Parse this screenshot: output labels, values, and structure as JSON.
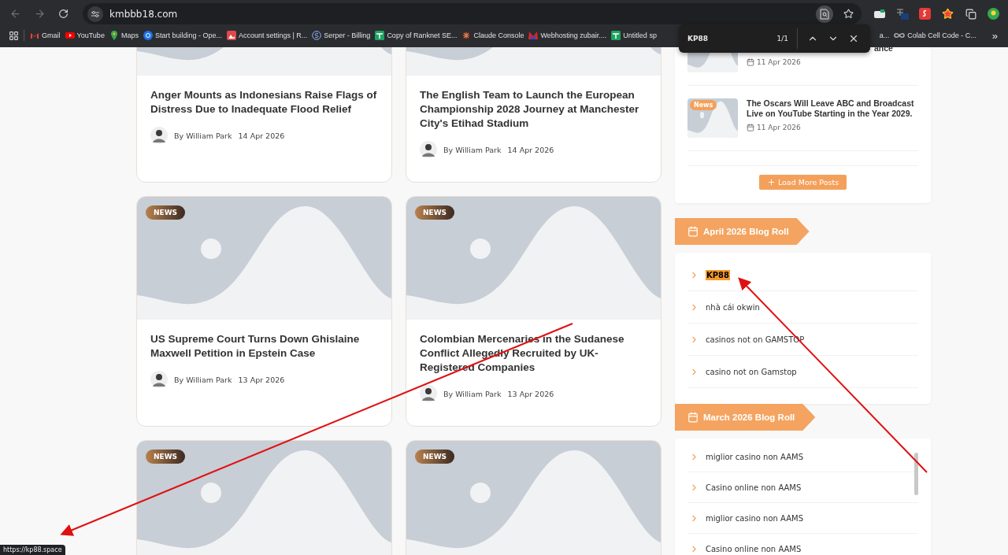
{
  "browser": {
    "url": "kmbbb18.com",
    "bookmarks": [
      {
        "label": "Gmail",
        "kind": "mail"
      },
      {
        "label": "YouTube",
        "kind": "video"
      },
      {
        "label": "Maps",
        "kind": "pin"
      },
      {
        "label": "Start building - Ope...",
        "kind": "gear"
      },
      {
        "label": "Account settings | R...",
        "kind": "photo"
      },
      {
        "label": "Serper - Billing",
        "kind": "circle"
      },
      {
        "label": "Copy of Ranknet SE...",
        "kind": "sheet"
      },
      {
        "label": "Claude Console",
        "kind": "burst"
      },
      {
        "label": "Webhosting zubair....",
        "kind": "letter"
      },
      {
        "label": "Untitled sp",
        "kind": "sheet"
      },
      {
        "label": "a...",
        "kind": "plain"
      },
      {
        "label": "Colab Cell Code - C...",
        "kind": "loop"
      }
    ],
    "more": "»"
  },
  "find_bar": {
    "query": "KP88",
    "count": "1/1"
  },
  "posts": [
    {
      "title": "Anger Mounts as Indonesians Raise Flags of Distress Due to Inadequate Flood Relief",
      "author": "By William Park",
      "date": "14 Apr 2026"
    },
    {
      "title": "The English Team to Launch the European Championship 2028 Journey at Manchester City's Etihad Stadium",
      "author": "By William Park",
      "date": "14 Apr 2026"
    },
    {
      "badge": "NEWS",
      "title": "US Supreme Court Turns Down Ghislaine Maxwell Petition in Epstein Case",
      "author": "By William Park",
      "date": "13 Apr 2026"
    },
    {
      "badge": "NEWS",
      "title": "Colombian Mercenaries in the Sudanese Conflict Allegedly Recruited by UK-Registered Companies",
      "author": "By William Park",
      "date": "13 Apr 2026"
    },
    {
      "badge": "NEWS"
    },
    {
      "badge": "NEWS"
    }
  ],
  "sidebar": {
    "recent": [
      {
        "kind": "partial",
        "title": "ance",
        "date": "11 Apr 2026"
      },
      {
        "kind": "full",
        "badge": "News",
        "title": "The Oscars Will Leave ABC and Broadcast Live on YouTube Starting in the Year 2029.",
        "date": "11 Apr 2026"
      }
    ],
    "load_more": "Load More Posts",
    "blog_rolls": [
      {
        "title": "April 2026 Blog Roll",
        "links": [
          {
            "label": "KP88",
            "highlighted": true
          },
          {
            "label": "nhà cái okwin",
            "highlighted": false
          },
          {
            "label": "casinos not on GAMSTOP",
            "highlighted": false
          },
          {
            "label": "casino not on Gamstop",
            "highlighted": false
          }
        ]
      },
      {
        "title": "March 2026 Blog Roll",
        "links": [
          {
            "label": "miglior casino non AAMS",
            "highlighted": false
          },
          {
            "label": "Casino online non AAMS",
            "highlighted": false
          },
          {
            "label": "miglior casino non AAMS",
            "highlighted": false
          },
          {
            "label": "Casino online non AAMS",
            "highlighted": false
          }
        ]
      }
    ]
  },
  "status_url": "https://kp88.space"
}
